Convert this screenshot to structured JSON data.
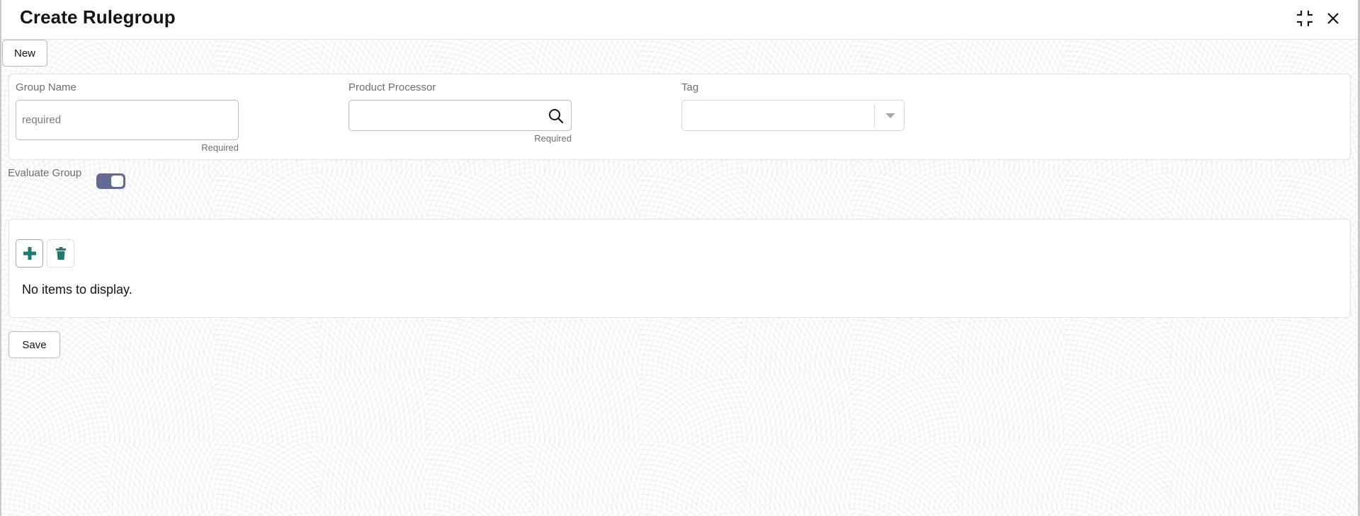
{
  "header": {
    "title": "Create Rulegroup",
    "icons": [
      "compress-icon",
      "close-icon"
    ]
  },
  "toolbar": {
    "new_label": "New",
    "save_label": "Save"
  },
  "form": {
    "group_name": {
      "label": "Group Name",
      "value": "",
      "placeholder": "required",
      "hint": "Required"
    },
    "product_processor": {
      "label": "Product Processor",
      "value": "",
      "placeholder": "",
      "hint": "Required",
      "icon": "search-icon"
    },
    "tag": {
      "label": "Tag",
      "selected": "",
      "icon": "chevron-down-icon"
    },
    "evaluate_group": {
      "label": "Evaluate Group",
      "on": true
    }
  },
  "table": {
    "add_icon": "plus-icon",
    "delete_icon": "trash-icon",
    "empty_message": "No items to display.",
    "rows": []
  },
  "colors": {
    "accent_teal": "#1f7a72",
    "toggle_on": "#646a94"
  }
}
